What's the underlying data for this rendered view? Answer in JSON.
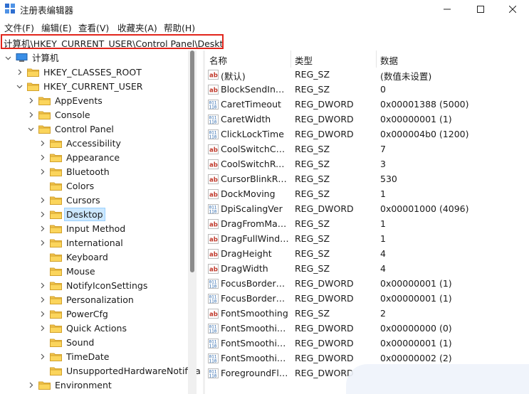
{
  "window": {
    "title": "注册表编辑器",
    "controls": [
      "minimize",
      "maximize",
      "close"
    ]
  },
  "menu": [
    "文件(F)",
    "编辑(E)",
    "查看(V)",
    "收藏夹(A)",
    "帮助(H)"
  ],
  "address": "计算机\\HKEY_CURRENT_USER\\Control Panel\\Desktop",
  "tree": [
    {
      "label": "计算机",
      "expanded": true,
      "kind": "computer"
    },
    {
      "label": "HKEY_CLASSES_ROOT",
      "expanded": false
    },
    {
      "label": "HKEY_CURRENT_USER",
      "expanded": true
    },
    {
      "label": "AppEvents",
      "expanded": false
    },
    {
      "label": "Console",
      "expanded": false
    },
    {
      "label": "Control Panel",
      "expanded": true
    },
    {
      "label": "Accessibility",
      "expanded": false
    },
    {
      "label": "Appearance",
      "expanded": false
    },
    {
      "label": "Bluetooth",
      "expanded": false
    },
    {
      "label": "Colors",
      "expanded": null
    },
    {
      "label": "Cursors",
      "expanded": false
    },
    {
      "label": "Desktop",
      "expanded": false,
      "selected": true
    },
    {
      "label": "Input Method",
      "expanded": false
    },
    {
      "label": "International",
      "expanded": false
    },
    {
      "label": "Keyboard",
      "expanded": null
    },
    {
      "label": "Mouse",
      "expanded": null
    },
    {
      "label": "NotifyIconSettings",
      "expanded": false
    },
    {
      "label": "Personalization",
      "expanded": false
    },
    {
      "label": "PowerCfg",
      "expanded": false
    },
    {
      "label": "Quick Actions",
      "expanded": false
    },
    {
      "label": "Sound",
      "expanded": null
    },
    {
      "label": "TimeDate",
      "expanded": false
    },
    {
      "label": "UnsupportedHardwareNotifica",
      "expanded": null
    },
    {
      "label": "Environment",
      "expanded": false
    }
  ],
  "columns": [
    "名称",
    "类型",
    "数据"
  ],
  "rows": [
    {
      "icon": "string",
      "name": "(默认)",
      "type": "REG_SZ",
      "data": "(数值未设置)"
    },
    {
      "icon": "string",
      "name": "BlockSendInpu...",
      "type": "REG_SZ",
      "data": "0"
    },
    {
      "icon": "dword",
      "name": "CaretTimeout",
      "type": "REG_DWORD",
      "data": "0x00001388 (5000)"
    },
    {
      "icon": "dword",
      "name": "CaretWidth",
      "type": "REG_DWORD",
      "data": "0x00000001 (1)"
    },
    {
      "icon": "dword",
      "name": "ClickLockTime",
      "type": "REG_DWORD",
      "data": "0x000004b0 (1200)"
    },
    {
      "icon": "string",
      "name": "CoolSwitchCol...",
      "type": "REG_SZ",
      "data": "7"
    },
    {
      "icon": "string",
      "name": "CoolSwitchRows",
      "type": "REG_SZ",
      "data": "3"
    },
    {
      "icon": "string",
      "name": "CursorBlinkRate",
      "type": "REG_SZ",
      "data": "530"
    },
    {
      "icon": "string",
      "name": "DockMoving",
      "type": "REG_SZ",
      "data": "1"
    },
    {
      "icon": "dword",
      "name": "DpiScalingVer",
      "type": "REG_DWORD",
      "data": "0x00001000 (4096)"
    },
    {
      "icon": "string",
      "name": "DragFromMaxi...",
      "type": "REG_SZ",
      "data": "1"
    },
    {
      "icon": "string",
      "name": "DragFullWindo...",
      "type": "REG_SZ",
      "data": "1"
    },
    {
      "icon": "string",
      "name": "DragHeight",
      "type": "REG_SZ",
      "data": "4"
    },
    {
      "icon": "string",
      "name": "DragWidth",
      "type": "REG_SZ",
      "data": "4"
    },
    {
      "icon": "dword",
      "name": "FocusBorderH...",
      "type": "REG_DWORD",
      "data": "0x00000001 (1)"
    },
    {
      "icon": "dword",
      "name": "FocusBorderW...",
      "type": "REG_DWORD",
      "data": "0x00000001 (1)"
    },
    {
      "icon": "string",
      "name": "FontSmoothing",
      "type": "REG_SZ",
      "data": "2"
    },
    {
      "icon": "dword",
      "name": "FontSmoothin...",
      "type": "REG_DWORD",
      "data": "0x00000000 (0)"
    },
    {
      "icon": "dword",
      "name": "FontSmoothin...",
      "type": "REG_DWORD",
      "data": "0x00000001 (1)"
    },
    {
      "icon": "dword",
      "name": "FontSmoothin...",
      "type": "REG_DWORD",
      "data": "0x00000002 (2)"
    },
    {
      "icon": "dword",
      "name": "ForegroundFla...",
      "type": "REG_DWORD",
      "data": ""
    }
  ],
  "colors": {
    "highlight_border": "#e1251b",
    "selection_bg": "#cce8ff",
    "folder": "#f3c44b",
    "string_icon": "#c0392b",
    "dword_icon": "#1f5fa8"
  }
}
